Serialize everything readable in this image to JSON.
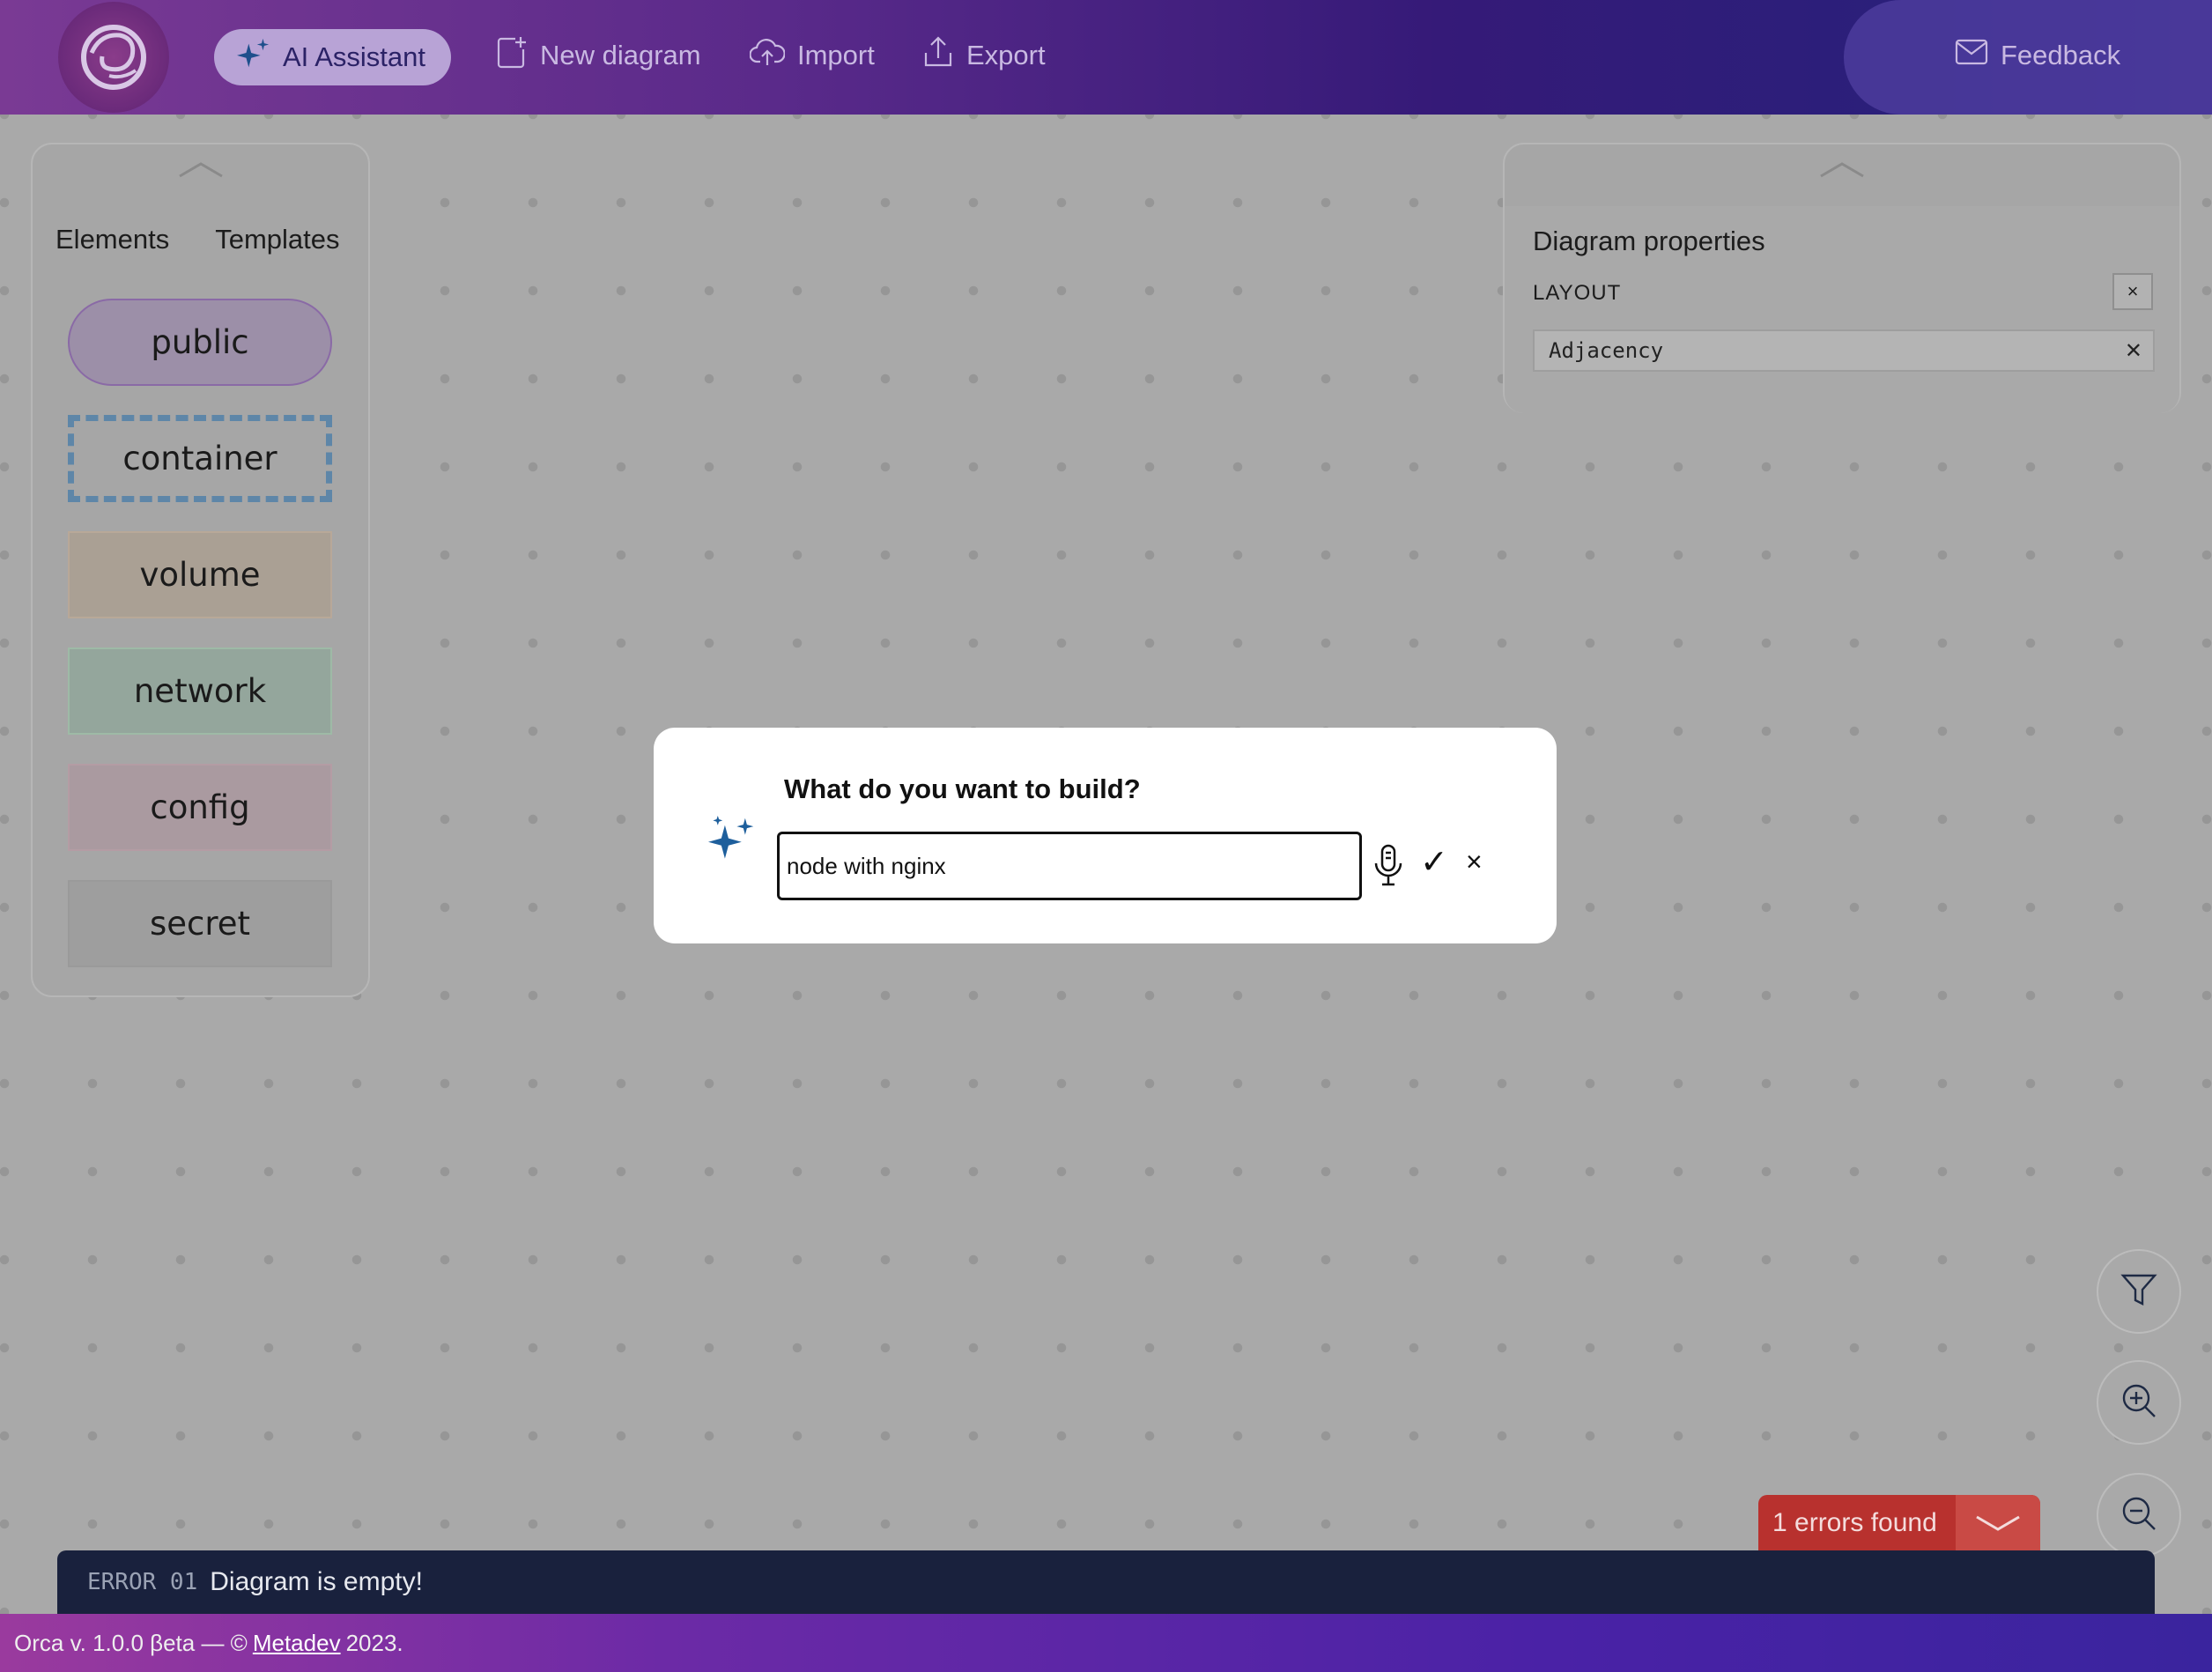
{
  "header": {
    "ai_assistant": "AI Assistant",
    "new_diagram": "New diagram",
    "import": "Import",
    "export": "Export",
    "feedback": "Feedback"
  },
  "left_panel": {
    "tabs": [
      "Elements",
      "Templates"
    ],
    "elements": [
      "public",
      "container",
      "volume",
      "network",
      "config",
      "secret"
    ]
  },
  "right_panel": {
    "title": "Diagram properties",
    "layout_label": "LAYOUT",
    "layout_value": "Adjacency"
  },
  "modal": {
    "title": "What do you want to build?",
    "input_value": "node with nginx",
    "ok": "✓",
    "cancel": "×"
  },
  "errors": {
    "summary": "1 errors found",
    "items": [
      {
        "code": "ERROR 01",
        "message": "Diagram is empty!"
      }
    ]
  },
  "footer": {
    "prefix": "Orca v. 1.0.0 βeta — ©",
    "link": "Metadev",
    "suffix": "2023."
  },
  "colors": {
    "brand_purple": "#5a2a8a",
    "error_red": "#b8312e",
    "error_bar": "#19213d",
    "sparkle_blue": "#1e5f9c"
  },
  "icons": [
    "logo-icon",
    "sparkle-icon",
    "new-diagram-icon",
    "upload-cloud-icon",
    "export-icon",
    "mail-icon",
    "chevron-up-icon",
    "filter-icon",
    "zoom-in-icon",
    "zoom-out-icon",
    "microphone-icon",
    "chevron-down-icon"
  ]
}
